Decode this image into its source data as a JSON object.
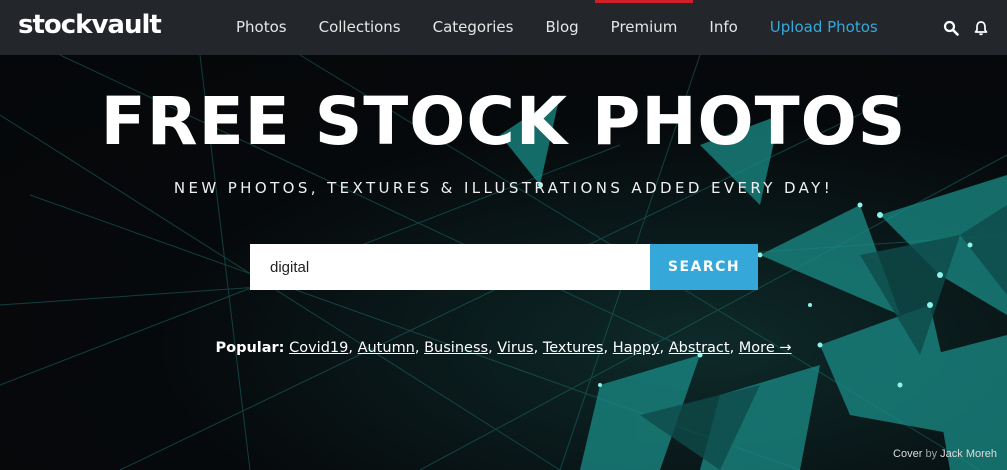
{
  "brand": {
    "logo": "stockvault"
  },
  "nav": {
    "items": [
      {
        "label": "Photos"
      },
      {
        "label": "Collections"
      },
      {
        "label": "Categories"
      },
      {
        "label": "Blog"
      },
      {
        "label": "Premium"
      },
      {
        "label": "Info"
      },
      {
        "label": "Upload Photos"
      }
    ],
    "icons": [
      "search-icon",
      "bell-icon"
    ]
  },
  "hero": {
    "title": "FREE STOCK PHOTOS",
    "subtitle": "NEW PHOTOS, TEXTURES & ILLUSTRATIONS ADDED EVERY DAY!",
    "search": {
      "value": "digital",
      "button_label": "SEARCH"
    },
    "popular_label": "Popular:",
    "popular_links": [
      "Covid19",
      "Autumn",
      "Business",
      "Virus",
      "Textures",
      "Happy",
      "Abstract"
    ],
    "more_link": "More →",
    "credit_prefix": "Cover",
    "credit_by": "by",
    "credit_author": "Jack Moreh"
  },
  "colors": {
    "nav_bg": "#23262b",
    "accent_blue": "#36a7d9",
    "premium_red": "#d0202a",
    "hero_teal": "#1fa5a0"
  }
}
